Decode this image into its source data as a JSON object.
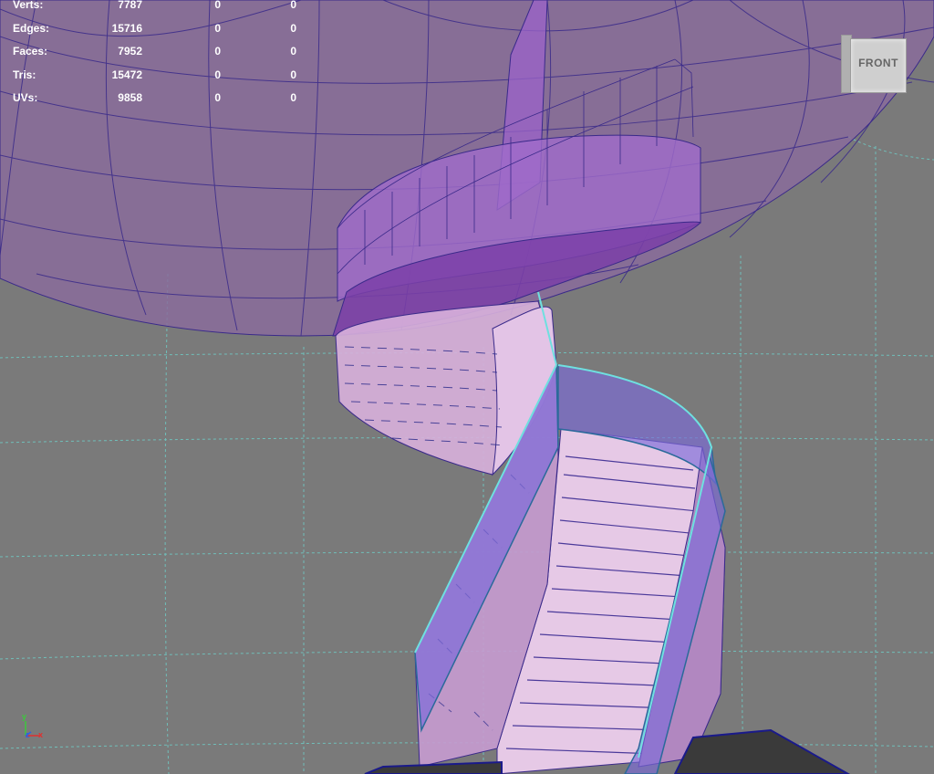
{
  "stats": [
    {
      "label": "Verts:",
      "total": "7787",
      "selected": "0",
      "other": "0"
    },
    {
      "label": "Edges:",
      "total": "15716",
      "selected": "0",
      "other": "0"
    },
    {
      "label": "Faces:",
      "total": "7952",
      "selected": "0",
      "other": "0"
    },
    {
      "label": "Tris:",
      "total": "15472",
      "selected": "0",
      "other": "0"
    },
    {
      "label": "UVs:",
      "total": "9858",
      "selected": "0",
      "other": "0"
    }
  ],
  "viewcube": {
    "face_label": "FRONT"
  },
  "axis": {
    "y": "y",
    "z": "z",
    "x": "x"
  },
  "colors": {
    "viewport_bg": "#7a7a7a",
    "grid": "#6fc6c0",
    "wire": "#3a2a8a",
    "dome_fill": "#8a6b9c",
    "stair_fill": "#c79bd0",
    "rail_glass": "#7d6bd8",
    "floor": "#3a3a3a"
  }
}
